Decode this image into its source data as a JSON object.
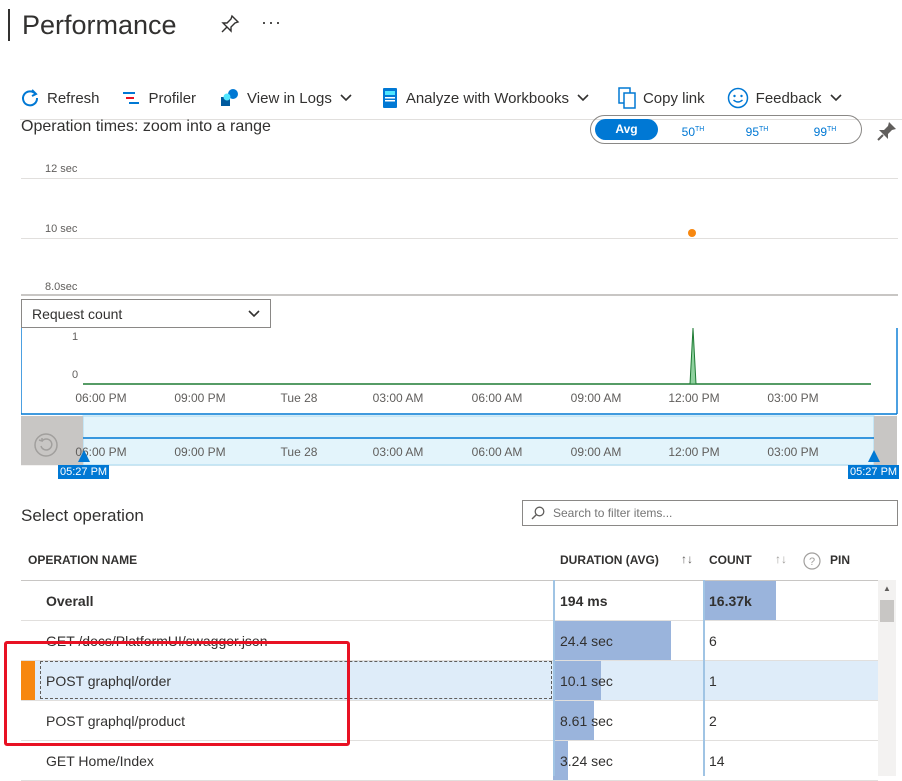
{
  "header": {
    "title": "Performance",
    "pin_icon": "pin-icon",
    "more_icon": "ellipsis-icon"
  },
  "toolbar": {
    "refresh": "Refresh",
    "profiler": "Profiler",
    "view_in_logs": "View in Logs",
    "analyze": "Analyze with Workbooks",
    "copy_link": "Copy link",
    "feedback": "Feedback"
  },
  "chart": {
    "title": "Operation times: zoom into a range",
    "percentiles": [
      "Avg",
      "50TH",
      "95TH",
      "99TH"
    ],
    "selected_percentile": "Avg",
    "y_ticks": [
      "12 sec",
      "10 sec",
      "8.0sec"
    ],
    "metric_dropdown": "Request count",
    "count_ticks": [
      "1",
      "0"
    ],
    "time_ticks": [
      "06:00 PM",
      "09:00 PM",
      "Tue 28",
      "03:00 AM",
      "06:00 AM",
      "09:00 AM",
      "12:00 PM",
      "03:00 PM"
    ],
    "range_start": "05:27 PM",
    "range_end": "05:27 PM",
    "accent_color": "#0078d4",
    "point_color": "#f7870f",
    "spike_color": "#1e7b34"
  },
  "chart_data": {
    "type": "line",
    "x": [
      "06:00 PM",
      "09:00 PM",
      "Tue 28",
      "03:00 AM",
      "06:00 AM",
      "09:00 AM",
      "12:00 PM",
      "03:00 PM"
    ],
    "series": [
      {
        "values": [
          0,
          0,
          0,
          0,
          0,
          0,
          1,
          0
        ]
      }
    ],
    "ylim": [
      0,
      1
    ]
  },
  "operations": {
    "section_title": "Select operation",
    "search_placeholder": "Search to filter items...",
    "columns": {
      "name": "OPERATION NAME",
      "duration": "DURATION (AVG)",
      "count": "COUNT",
      "pin": "PIN"
    },
    "rows": [
      {
        "name": "Overall",
        "duration": "194 ms",
        "count": "16.37k",
        "dur_frac": 0.0,
        "count_frac": 1.0,
        "bold": true
      },
      {
        "name": "GET /docs/PlatformUI/swagger.json",
        "duration": "24.4 sec",
        "count": "6",
        "dur_frac": 1.0,
        "count_frac": 0.0
      },
      {
        "name": "POST graphql/order",
        "duration": "10.1 sec",
        "count": "1",
        "dur_frac": 0.41,
        "count_frac": 0.0,
        "selected": true
      },
      {
        "name": "POST graphql/product",
        "duration": "8.61 sec",
        "count": "2",
        "dur_frac": 0.35,
        "count_frac": 0.0
      },
      {
        "name": "GET Home/Index",
        "duration": "3.24 sec",
        "count": "14",
        "dur_frac": 0.13,
        "count_frac": 0.0
      }
    ]
  }
}
